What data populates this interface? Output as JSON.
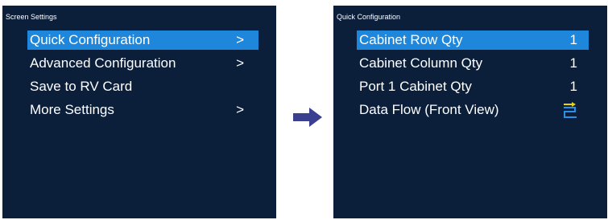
{
  "left_screen": {
    "title": "Screen Settings",
    "items": [
      {
        "label": "Quick Configuration",
        "arrow": ">",
        "selected": true
      },
      {
        "label": "Advanced Configuration",
        "arrow": ">",
        "selected": false
      },
      {
        "label": "Save to RV Card",
        "arrow": "",
        "selected": false
      },
      {
        "label": "More Settings",
        "arrow": ">",
        "selected": false
      }
    ]
  },
  "right_screen": {
    "title": "Quick Configuration",
    "items": [
      {
        "label": "Cabinet Row Qty",
        "value": "1",
        "selected": true
      },
      {
        "label": "Cabinet Column Qty",
        "value": "1",
        "selected": false
      },
      {
        "label": "Port 1 Cabinet Qty",
        "value": "1",
        "selected": false
      },
      {
        "label": "Data Flow (Front View)",
        "value_icon": "data-flow-icon",
        "selected": false
      }
    ]
  },
  "transition_arrow": {
    "icon": "right-arrow-icon",
    "color": "#3a3f8f"
  },
  "colors": {
    "screen_bg": "#0b1e3a",
    "highlight": "#1e87dc",
    "flow_icon_line": "#2a8fe6",
    "flow_icon_arrow": "#e8d21c"
  }
}
